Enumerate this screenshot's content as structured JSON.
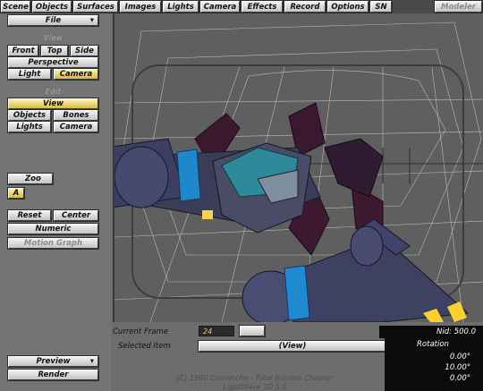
{
  "tabs": [
    "Scene",
    "Objects",
    "Surfaces",
    "Images",
    "Lights",
    "Camera",
    "Effects",
    "Record",
    "Options",
    "SN"
  ],
  "modeler_label": "Modeler",
  "file_menu": "File",
  "view_section": {
    "label": "View",
    "buttons": [
      "Front",
      "Top",
      "Side",
      "Perspective",
      "Light",
      "Camera"
    ]
  },
  "edit_section": {
    "label": "Edit",
    "buttons": [
      "View",
      "Objects",
      "Bones",
      "Lights",
      "Camera"
    ]
  },
  "zoom_label": "Zoo",
  "zoom_a": "A",
  "actions": [
    "Reset",
    "Center",
    "Numeric",
    "Motion Graph"
  ],
  "preview_label": "Preview",
  "render_label": "Render",
  "timeline": {
    "current_frame_label": "Current Frame",
    "current_frame_value": "24",
    "selected_item_label": "Selected Item",
    "selected_item_value": "(View)",
    "grid_value": "Nid: 500.0",
    "rotation_label": "Rotation",
    "rotation_values": [
      "0.00°",
      "10.00°",
      "0.00°"
    ]
  },
  "credits": {
    "copyright": "(C) 1990 Comanche - Total Rumble Chapter",
    "version": "LightWave 3D 5.0"
  },
  "colors": {
    "active_button": "#e0c24b",
    "field_text": "#e6d45c",
    "grid_lines": "#e8e8e8"
  }
}
